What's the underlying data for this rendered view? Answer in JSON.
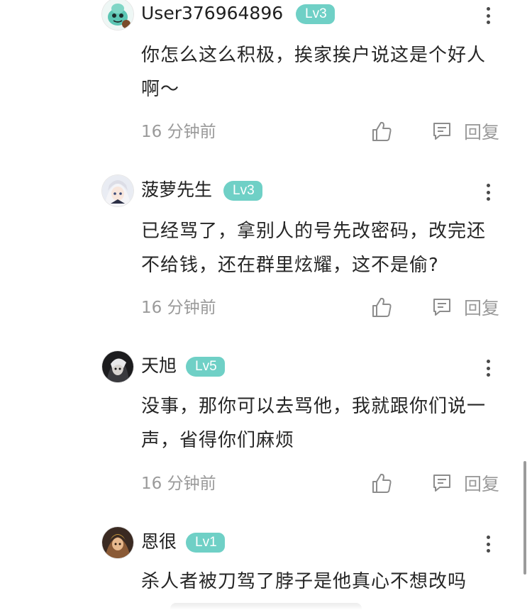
{
  "comments": [
    {
      "username": "User376964896",
      "level": "Lv3",
      "content": "你怎么这么积极，挨家挨户说这是个好人啊～",
      "time": "16 分钟前",
      "reply_label": "回复",
      "avatar_icon": "teal-creature-avatar"
    },
    {
      "username": "菠萝先生",
      "level": "Lv3",
      "content": "已经骂了，拿别人的号先改密码，改完还不给钱，还在群里炫耀，这不是偷?",
      "time": "16 分钟前",
      "reply_label": "回复",
      "avatar_icon": "white-hair-anime-avatar"
    },
    {
      "username": "天旭",
      "level": "Lv5",
      "content": "没事，那你可以去骂他，我就跟你们说一声，省得你们麻烦",
      "time": "16 分钟前",
      "reply_label": "回复",
      "avatar_icon": "dark-anime-avatar"
    },
    {
      "username": "恩很",
      "level": "Lv1",
      "content": "杀人者被刀驾了脖子是他真心不想改吗",
      "avatar_icon": "fantasy-character-avatar"
    }
  ],
  "colors": {
    "level_badge": "#6fd0c6",
    "secondary_text": "#9a9a9a"
  }
}
